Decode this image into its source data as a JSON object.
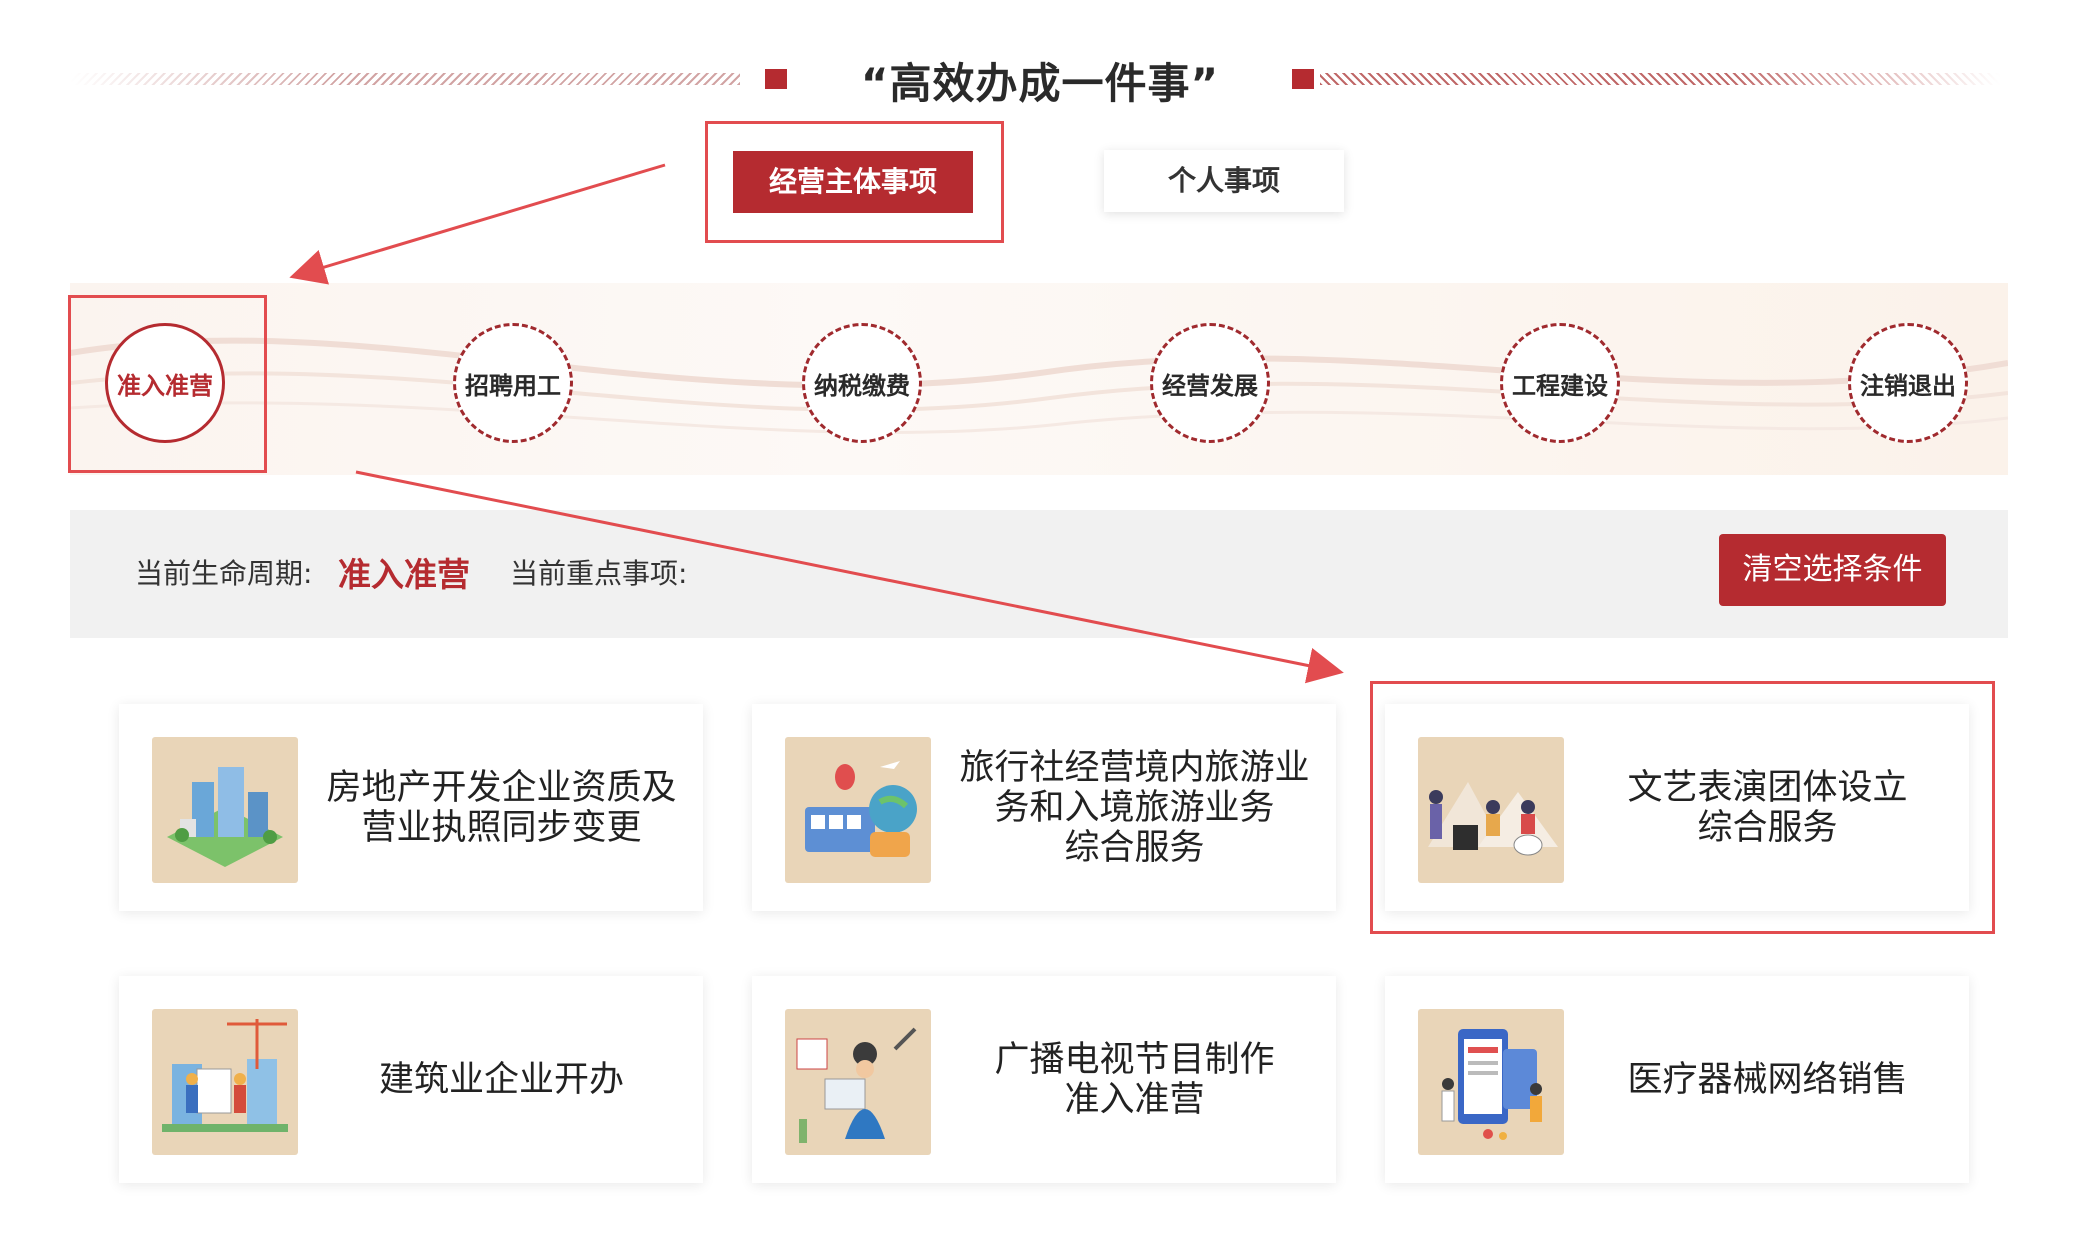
{
  "header": {
    "title": "“高效办成一件事”"
  },
  "tabs": [
    {
      "label": "经营主体事项",
      "active": true
    },
    {
      "label": "个人事项",
      "active": false
    }
  ],
  "lifecycle": {
    "stages": [
      {
        "label": "准入准营",
        "active": true
      },
      {
        "label": "招聘用工",
        "active": false
      },
      {
        "label": "纳税缴费",
        "active": false
      },
      {
        "label": "经营发展",
        "active": false
      },
      {
        "label": "工程建设",
        "active": false
      },
      {
        "label": "注销退出",
        "active": false
      }
    ]
  },
  "status_bar": {
    "current_cycle_label": "当前生命周期:",
    "current_cycle_value": "准入准营",
    "current_item_label": "当前重点事项:",
    "clear_button": "清空选择条件"
  },
  "cards": [
    {
      "title": "房地产开发企业资质及\n营业执照同步变更",
      "icon": "real-estate-illustration"
    },
    {
      "title": "旅行社经营境内旅游业\n务和入境旅游业务\n综合服务",
      "icon": "travel-agency-illustration"
    },
    {
      "title": "文艺表演团体设立\n综合服务",
      "icon": "performance-troupe-illustration",
      "highlighted": true
    },
    {
      "title": "建筑业企业开办",
      "icon": "construction-illustration"
    },
    {
      "title": "广播电视节目制作\n准入准营",
      "icon": "broadcast-illustration"
    },
    {
      "title": "医疗器械网络销售",
      "icon": "medical-device-illustration"
    }
  ],
  "colors": {
    "brand": "#b52b30",
    "annotation": "#e24c4f"
  }
}
